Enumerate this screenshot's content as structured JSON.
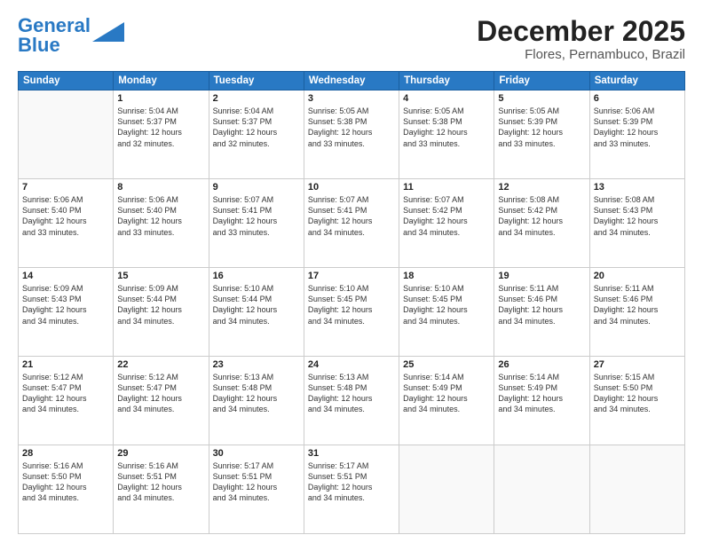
{
  "header": {
    "logo_line1": "General",
    "logo_line2": "Blue",
    "month": "December 2025",
    "location": "Flores, Pernambuco, Brazil"
  },
  "weekdays": [
    "Sunday",
    "Monday",
    "Tuesday",
    "Wednesday",
    "Thursday",
    "Friday",
    "Saturday"
  ],
  "weeks": [
    [
      {
        "day": "",
        "info": ""
      },
      {
        "day": "1",
        "info": "Sunrise: 5:04 AM\nSunset: 5:37 PM\nDaylight: 12 hours\nand 32 minutes."
      },
      {
        "day": "2",
        "info": "Sunrise: 5:04 AM\nSunset: 5:37 PM\nDaylight: 12 hours\nand 32 minutes."
      },
      {
        "day": "3",
        "info": "Sunrise: 5:05 AM\nSunset: 5:38 PM\nDaylight: 12 hours\nand 33 minutes."
      },
      {
        "day": "4",
        "info": "Sunrise: 5:05 AM\nSunset: 5:38 PM\nDaylight: 12 hours\nand 33 minutes."
      },
      {
        "day": "5",
        "info": "Sunrise: 5:05 AM\nSunset: 5:39 PM\nDaylight: 12 hours\nand 33 minutes."
      },
      {
        "day": "6",
        "info": "Sunrise: 5:06 AM\nSunset: 5:39 PM\nDaylight: 12 hours\nand 33 minutes."
      }
    ],
    [
      {
        "day": "7",
        "info": "Sunrise: 5:06 AM\nSunset: 5:40 PM\nDaylight: 12 hours\nand 33 minutes."
      },
      {
        "day": "8",
        "info": "Sunrise: 5:06 AM\nSunset: 5:40 PM\nDaylight: 12 hours\nand 33 minutes."
      },
      {
        "day": "9",
        "info": "Sunrise: 5:07 AM\nSunset: 5:41 PM\nDaylight: 12 hours\nand 33 minutes."
      },
      {
        "day": "10",
        "info": "Sunrise: 5:07 AM\nSunset: 5:41 PM\nDaylight: 12 hours\nand 34 minutes."
      },
      {
        "day": "11",
        "info": "Sunrise: 5:07 AM\nSunset: 5:42 PM\nDaylight: 12 hours\nand 34 minutes."
      },
      {
        "day": "12",
        "info": "Sunrise: 5:08 AM\nSunset: 5:42 PM\nDaylight: 12 hours\nand 34 minutes."
      },
      {
        "day": "13",
        "info": "Sunrise: 5:08 AM\nSunset: 5:43 PM\nDaylight: 12 hours\nand 34 minutes."
      }
    ],
    [
      {
        "day": "14",
        "info": "Sunrise: 5:09 AM\nSunset: 5:43 PM\nDaylight: 12 hours\nand 34 minutes."
      },
      {
        "day": "15",
        "info": "Sunrise: 5:09 AM\nSunset: 5:44 PM\nDaylight: 12 hours\nand 34 minutes."
      },
      {
        "day": "16",
        "info": "Sunrise: 5:10 AM\nSunset: 5:44 PM\nDaylight: 12 hours\nand 34 minutes."
      },
      {
        "day": "17",
        "info": "Sunrise: 5:10 AM\nSunset: 5:45 PM\nDaylight: 12 hours\nand 34 minutes."
      },
      {
        "day": "18",
        "info": "Sunrise: 5:10 AM\nSunset: 5:45 PM\nDaylight: 12 hours\nand 34 minutes."
      },
      {
        "day": "19",
        "info": "Sunrise: 5:11 AM\nSunset: 5:46 PM\nDaylight: 12 hours\nand 34 minutes."
      },
      {
        "day": "20",
        "info": "Sunrise: 5:11 AM\nSunset: 5:46 PM\nDaylight: 12 hours\nand 34 minutes."
      }
    ],
    [
      {
        "day": "21",
        "info": "Sunrise: 5:12 AM\nSunset: 5:47 PM\nDaylight: 12 hours\nand 34 minutes."
      },
      {
        "day": "22",
        "info": "Sunrise: 5:12 AM\nSunset: 5:47 PM\nDaylight: 12 hours\nand 34 minutes."
      },
      {
        "day": "23",
        "info": "Sunrise: 5:13 AM\nSunset: 5:48 PM\nDaylight: 12 hours\nand 34 minutes."
      },
      {
        "day": "24",
        "info": "Sunrise: 5:13 AM\nSunset: 5:48 PM\nDaylight: 12 hours\nand 34 minutes."
      },
      {
        "day": "25",
        "info": "Sunrise: 5:14 AM\nSunset: 5:49 PM\nDaylight: 12 hours\nand 34 minutes."
      },
      {
        "day": "26",
        "info": "Sunrise: 5:14 AM\nSunset: 5:49 PM\nDaylight: 12 hours\nand 34 minutes."
      },
      {
        "day": "27",
        "info": "Sunrise: 5:15 AM\nSunset: 5:50 PM\nDaylight: 12 hours\nand 34 minutes."
      }
    ],
    [
      {
        "day": "28",
        "info": "Sunrise: 5:16 AM\nSunset: 5:50 PM\nDaylight: 12 hours\nand 34 minutes."
      },
      {
        "day": "29",
        "info": "Sunrise: 5:16 AM\nSunset: 5:51 PM\nDaylight: 12 hours\nand 34 minutes."
      },
      {
        "day": "30",
        "info": "Sunrise: 5:17 AM\nSunset: 5:51 PM\nDaylight: 12 hours\nand 34 minutes."
      },
      {
        "day": "31",
        "info": "Sunrise: 5:17 AM\nSunset: 5:51 PM\nDaylight: 12 hours\nand 34 minutes."
      },
      {
        "day": "",
        "info": ""
      },
      {
        "day": "",
        "info": ""
      },
      {
        "day": "",
        "info": ""
      }
    ]
  ]
}
